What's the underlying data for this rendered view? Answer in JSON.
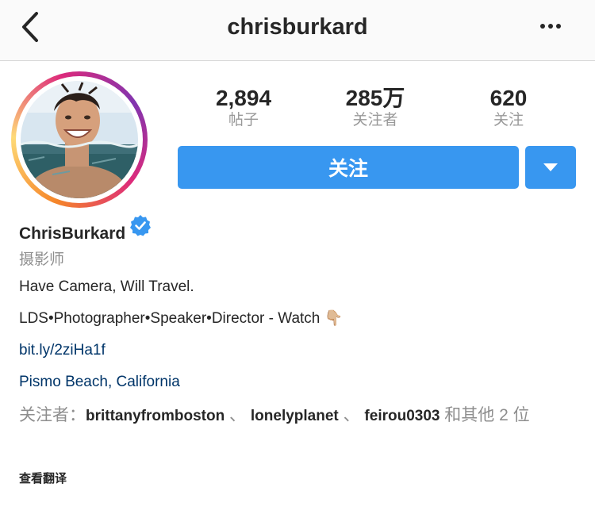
{
  "header": {
    "username": "chrisburkard"
  },
  "stats": [
    {
      "value": "2,894",
      "label": "帖子"
    },
    {
      "value": "285万",
      "label": "关注者"
    },
    {
      "value": "620",
      "label": "关注"
    }
  ],
  "actions": {
    "follow_label": "关注"
  },
  "profile": {
    "name": "ChrisBurkard",
    "category": "摄影师",
    "bio_line1": "Have Camera, Will Travel.",
    "bio_line2": "LDS•Photographer•Speaker•Director - Watch",
    "bio_emoji": "👇🏼",
    "link": "bit.ly/2ziHa1f",
    "location": "Pismo Beach, California"
  },
  "followed_by": {
    "prefix": "关注者：",
    "users": [
      "brittanyfromboston",
      "lonelyplanet",
      "feirou0303"
    ],
    "separator": " 、 ",
    "suffix": " 和其他 2 位"
  },
  "see_translation": "查看翻译",
  "colors": {
    "primary_button": "#3897f0",
    "link_text": "#003569",
    "muted_text": "#8e8e8e",
    "verified_badge": "#3897f0"
  },
  "icons": {
    "back": "chevron-left-icon",
    "more": "more-horizontal-icon",
    "dropdown": "caret-down-icon",
    "verified": "verified-badge-icon"
  }
}
